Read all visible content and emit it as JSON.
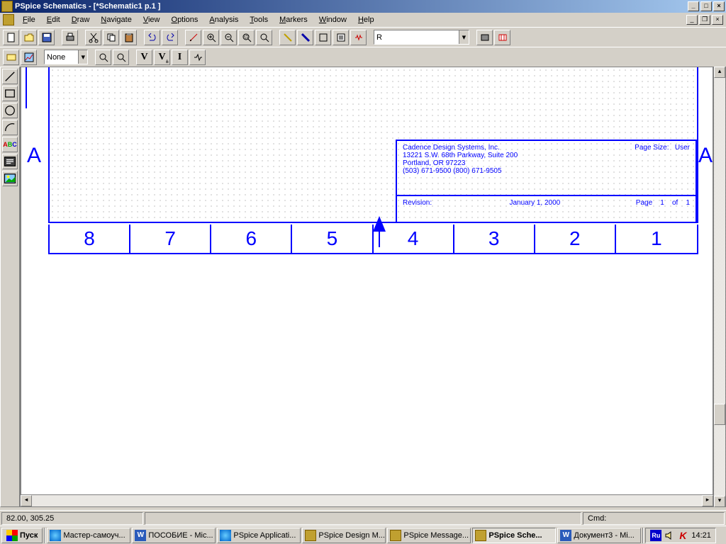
{
  "titlebar": {
    "app": "PSpice Schematics",
    "doc": "[*Schematic1   p.1    ]"
  },
  "menu": [
    "File",
    "Edit",
    "Draw",
    "Navigate",
    "View",
    "Options",
    "Analysis",
    "Tools",
    "Markers",
    "Window",
    "Help"
  ],
  "toolbar2": {
    "combo": "None",
    "btns": [
      "V",
      "V",
      "I"
    ]
  },
  "partcombo": "R",
  "ruler_cols": [
    "8",
    "7",
    "6",
    "5",
    "4",
    "3",
    "2",
    "1"
  ],
  "ruler_row": "A",
  "titleblock": {
    "l1": "Cadence Design Systems, Inc.",
    "l2": "13221 S.W. 68th Parkway, Suite 200",
    "l3": "Portland, OR 97223",
    "l4": "(503) 671-9500    (800) 671-9505",
    "pagesize_lbl": "Page Size:",
    "pagesize_val": "User",
    "rev_lbl": "Revision:",
    "rev_val": "",
    "date": "January 1, 2000",
    "page_lbl": "Page",
    "page_n": "1",
    "of": "of",
    "page_total": "1"
  },
  "status": {
    "coords": "82.00, 305.25",
    "cmd_lbl": "Cmd:"
  },
  "taskbar": {
    "start": "Пуск",
    "items": [
      "Мастер-самоуч...",
      "ПОСОБИЕ - Mic...",
      "PSpice Applicati...",
      "PSpice Design M...",
      "PSpice Message...",
      "PSpice Sche...",
      "Документ3 - Mi..."
    ],
    "active_index": 5,
    "tray": {
      "lang": "Ru",
      "clock": "14:21"
    }
  }
}
